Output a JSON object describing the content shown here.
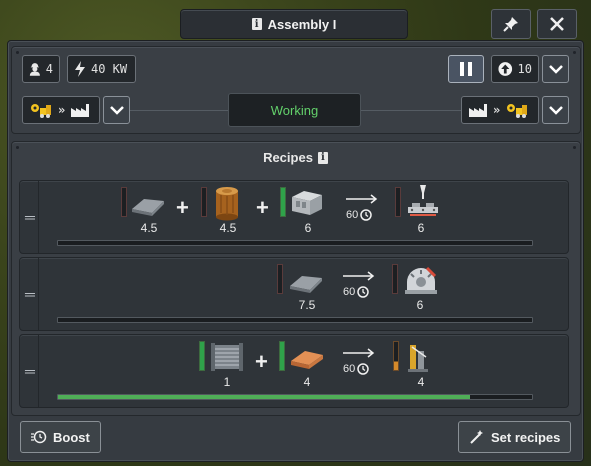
{
  "window": {
    "title": "Assembly I"
  },
  "header": {
    "workers": "4",
    "power": "40 KW",
    "priority": "10",
    "status": "Working"
  },
  "recipes": {
    "title": "Recipes",
    "rows": [
      {
        "inputs": [
          {
            "icon": "steel-plate-icon",
            "amount": "4.5"
          },
          {
            "icon": "wood-icon",
            "amount": "4.5"
          },
          {
            "icon": "concrete-block-icon",
            "amount": "6"
          }
        ],
        "duration": "60",
        "outputs": [
          {
            "icon": "construction-parts-icon",
            "amount": "6"
          }
        ],
        "progress": 0
      },
      {
        "inputs": [
          {
            "icon": "steel-plate-icon",
            "amount": "7.5"
          }
        ],
        "duration": "60",
        "outputs": [
          {
            "icon": "mechanical-parts-icon",
            "amount": "6"
          }
        ],
        "progress": 0
      },
      {
        "inputs": [
          {
            "icon": "iron-spool-icon",
            "amount": "1"
          },
          {
            "icon": "copper-plate-icon",
            "amount": "4"
          }
        ],
        "duration": "60",
        "outputs": [
          {
            "icon": "electronics-icon",
            "amount": "4"
          }
        ],
        "progress": 0.87
      }
    ]
  },
  "footer": {
    "boost_label": "Boost",
    "set_recipes_label": "Set recipes"
  },
  "colors": {
    "status": "#63d16b",
    "progress": "#4fae57",
    "full_gauge": "#2fa24a"
  }
}
